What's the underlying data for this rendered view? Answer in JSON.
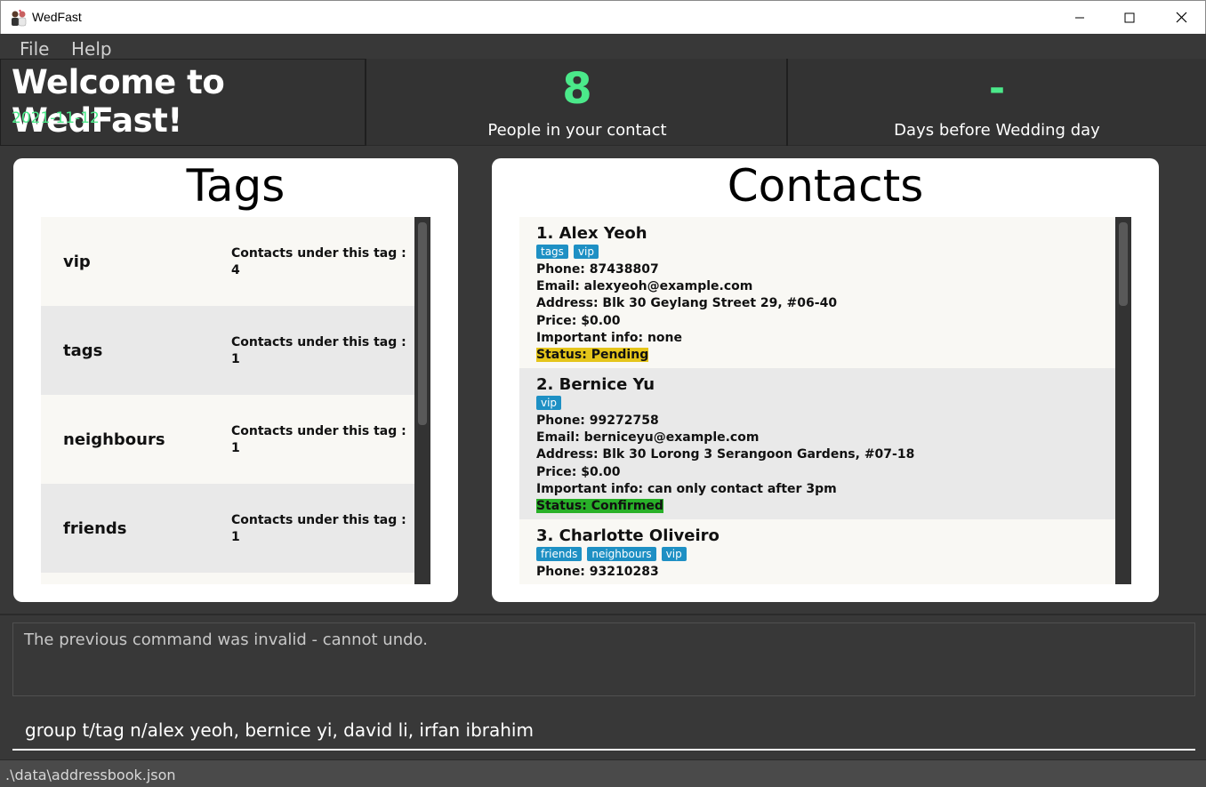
{
  "window": {
    "title": "WedFast",
    "icon": "couple-icon"
  },
  "menu": {
    "items": [
      "File",
      "Help"
    ]
  },
  "header": {
    "welcome": "Welcome to WedFast!",
    "date": "2021-11-12",
    "people_count": "8",
    "people_label": "People in your contact",
    "days_value": "-",
    "days_label": "Days before Wedding day"
  },
  "tags_panel": {
    "title": "Tags",
    "count_prefix": "Contacts under this tag :",
    "items": [
      {
        "name": "vip",
        "count": "4"
      },
      {
        "name": "tags",
        "count": "1"
      },
      {
        "name": "neighbours",
        "count": "1"
      },
      {
        "name": "friends",
        "count": "1"
      }
    ]
  },
  "contacts_panel": {
    "title": "Contacts",
    "items": [
      {
        "name": "1.  Alex Yeoh",
        "tags": [
          "tags",
          "vip"
        ],
        "phone": "Phone: 87438807",
        "email": "Email: alexyeoh@example.com",
        "address": "Address: Blk 30 Geylang Street 29, #06-40",
        "price": "Price: $0.00",
        "info": "Important info: none",
        "status": "Status: Pending"
      },
      {
        "name": "2.  Bernice Yu",
        "tags": [
          "vip"
        ],
        "phone": "Phone: 99272758",
        "email": "Email: berniceyu@example.com",
        "address": "Address: Blk 30 Lorong 3 Serangoon Gardens, #07-18",
        "price": "Price: $0.00",
        "info": "Important info: can only contact after 3pm",
        "status": "Status: Confirmed"
      },
      {
        "name": "3.  Charlotte Oliveiro",
        "tags": [
          "friends",
          "neighbours",
          "vip"
        ],
        "phone": "Phone: 93210283"
      }
    ]
  },
  "result": {
    "message": "The previous command was invalid - cannot undo."
  },
  "command": {
    "value": "group t/tag n/alex yeoh, bernice yi, david li, irfan ibrahim"
  },
  "statusbar": {
    "path": ".\\data\\addressbook.json"
  },
  "colors": {
    "accent_green": "#4be98a",
    "tag_chip": "#1e90c4",
    "status_pending": "#e5c51a",
    "status_confirmed": "#28b028"
  }
}
